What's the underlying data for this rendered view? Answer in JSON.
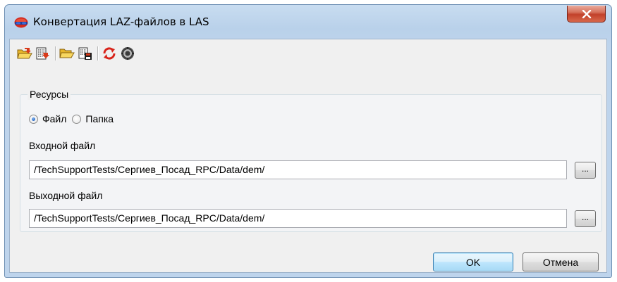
{
  "window": {
    "title": "Конвертация LAZ-файлов в LAS",
    "close_label": "X"
  },
  "toolbar": {
    "buttons": [
      {
        "icon": "open-list-icon"
      },
      {
        "icon": "save-list-icon"
      },
      {
        "icon": "open-folder-icon"
      },
      {
        "icon": "save-icon"
      },
      {
        "icon": "refresh-icon"
      },
      {
        "icon": "process-icon"
      }
    ]
  },
  "resources": {
    "group_label": "Ресурсы",
    "options": [
      {
        "label": "Файл",
        "checked": true
      },
      {
        "label": "Папка",
        "checked": false
      }
    ],
    "input_file": {
      "label": "Входной файл",
      "value": "/TechSupportTests/Сергиев_Посад_RPC/Data/dem/",
      "browse_label": "..."
    },
    "output_file": {
      "label": "Выходной файл",
      "value": "/TechSupportTests/Сергиев_Посад_RPC/Data/dem/",
      "browse_label": "..."
    }
  },
  "buttons": {
    "ok": "OK",
    "cancel": "Отмена"
  },
  "colors": {
    "title_gradient": "#b9d1ea",
    "close_red": "#c2412a",
    "client_bg": "#f0f0f0"
  }
}
